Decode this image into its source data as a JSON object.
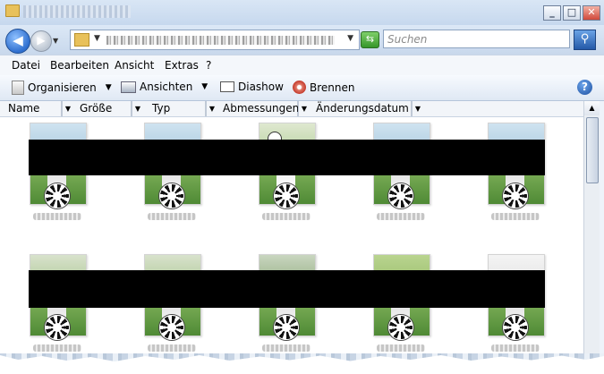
{
  "window": {
    "minimize_glyph": "_",
    "maximize_glyph": "□",
    "close_glyph": "✕"
  },
  "address": {
    "back_glyph": "◀",
    "forward_glyph": "▶",
    "dropdown_glyph": "▼",
    "refresh_glyph": "⇆"
  },
  "search": {
    "placeholder": "Suchen",
    "button_glyph": "⚲"
  },
  "menu": {
    "items": [
      "Datei",
      "Bearbeiten",
      "Ansicht",
      "Extras",
      "?"
    ]
  },
  "toolbar": {
    "organize": "Organisieren",
    "views": "Ansichten",
    "slideshow": "Diashow",
    "burn": "Brennen",
    "dropdown_glyph": "▼",
    "help_glyph": "?"
  },
  "columns": {
    "name": "Name",
    "size": "Größe",
    "type": "Typ",
    "dimensions": "Abmessungen",
    "date": "Änderungsdatum",
    "dropdown_glyph": "▼"
  },
  "scrollbar": {
    "up_glyph": "▲"
  },
  "icons": {
    "folder": "folder-icon",
    "back": "back-arrow-icon",
    "forward": "forward-arrow-icon",
    "refresh": "refresh-icon",
    "search": "search-icon",
    "organize": "organize-icon",
    "views": "views-icon",
    "slideshow": "slideshow-icon",
    "burn": "burn-disc-icon",
    "help": "help-icon"
  }
}
